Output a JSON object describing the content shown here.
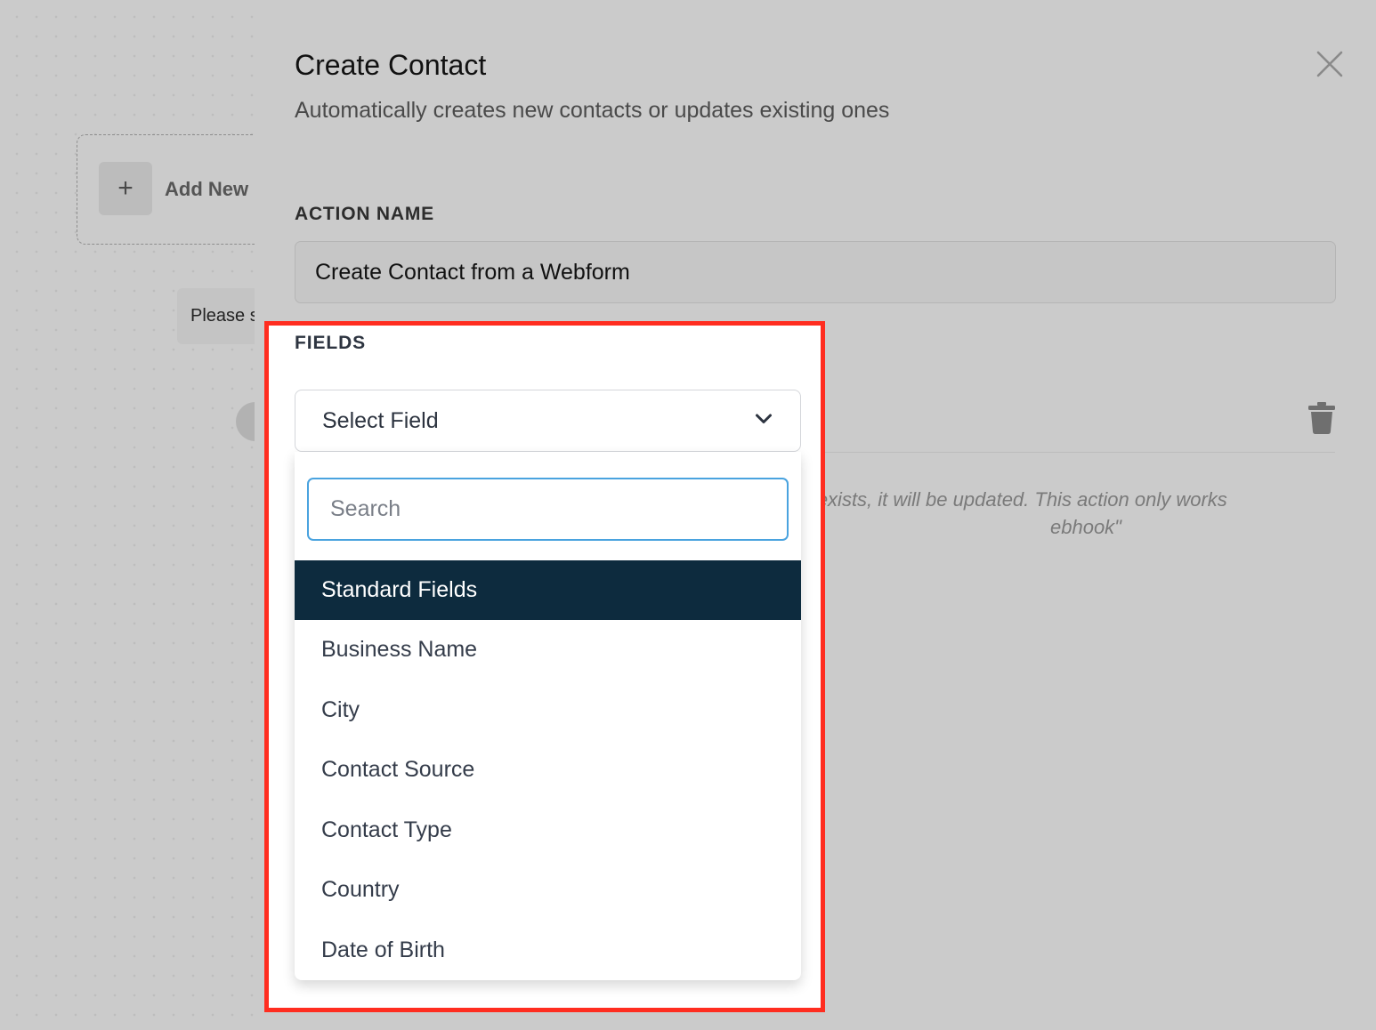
{
  "canvas": {
    "add_new_label": "Add New",
    "add_icon": "plus-icon",
    "tooltip_text": "Please s"
  },
  "panel": {
    "title": "Create Contact",
    "subtitle": "Automatically creates new contacts or updates existing ones",
    "close_icon": "close-icon",
    "action_name_label": "ACTION NAME",
    "action_name_value": "Create Contact from a Webform",
    "fields_label": "FIELDS",
    "help_text_line1": "eady exists, it will be updated. This action only works",
    "help_text_line2": "ebhook\""
  },
  "select": {
    "selected": "Select Field",
    "search_placeholder": "Search",
    "group_label": "Standard Fields",
    "options": [
      "Business Name",
      "City",
      "Contact Source",
      "Contact Type",
      "Country",
      "Date of Birth"
    ]
  },
  "colors": {
    "highlight_border": "#ff2d20",
    "group_header_bg": "#0d2b3e",
    "search_focus": "#4aa3df"
  }
}
